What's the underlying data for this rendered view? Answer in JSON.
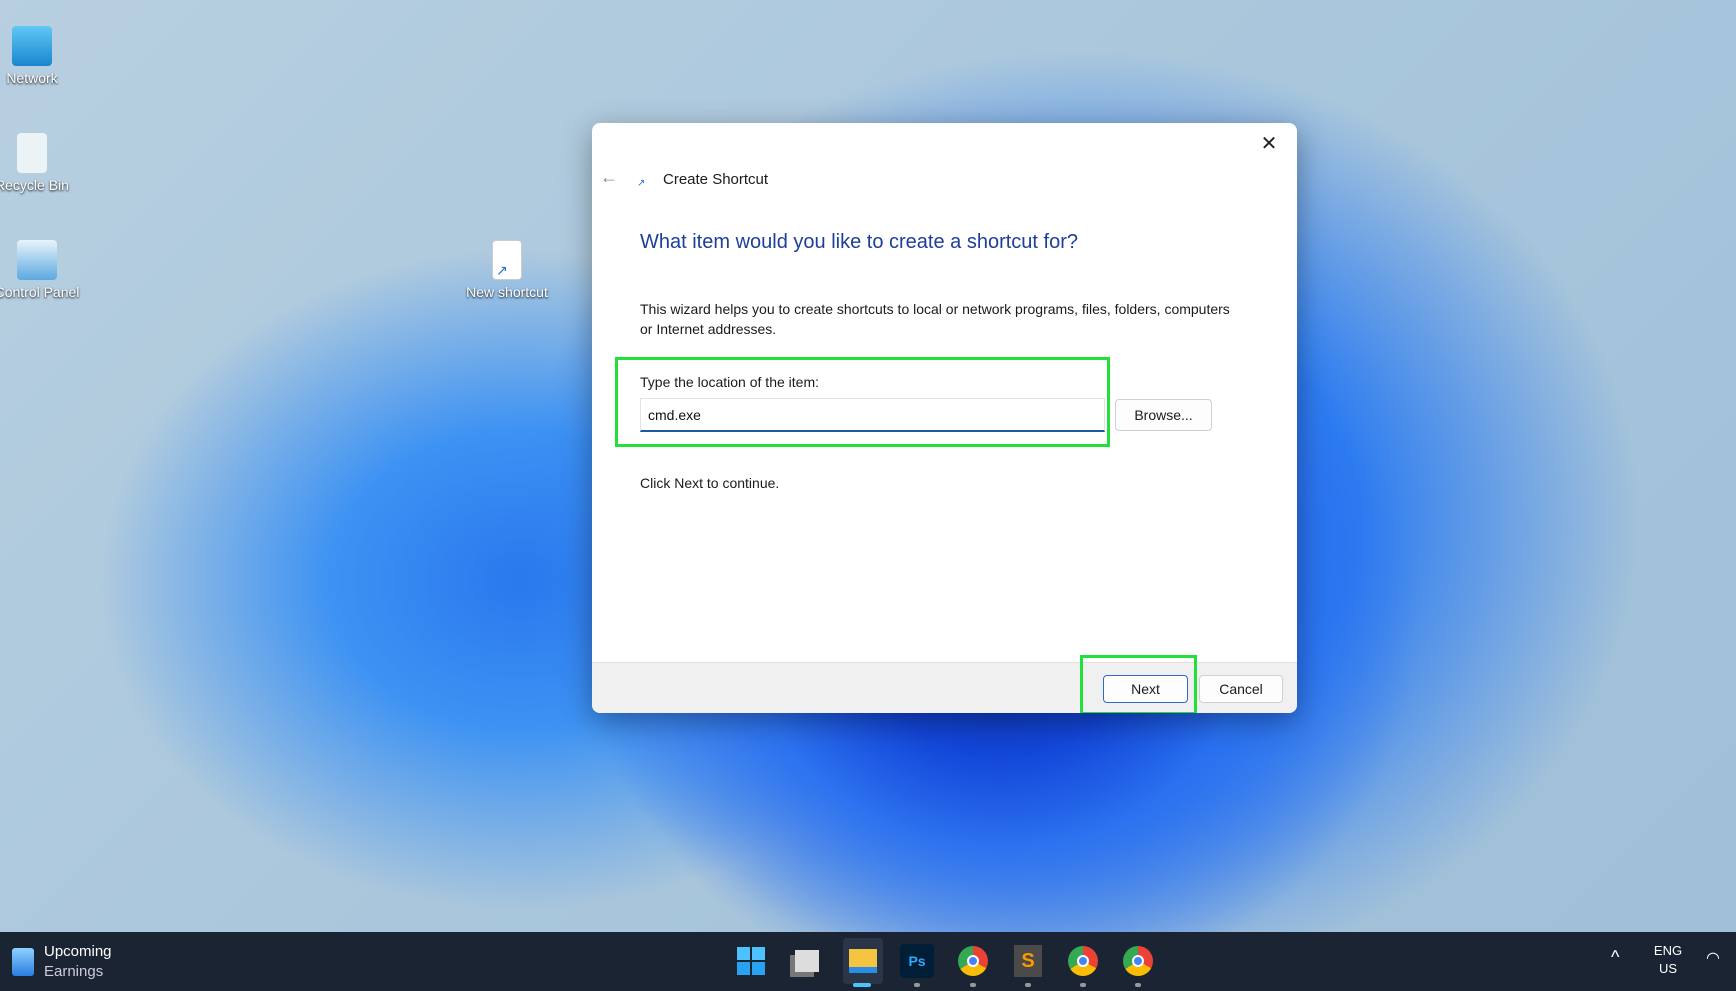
{
  "desktop": {
    "icons": [
      {
        "label": "Network"
      },
      {
        "label": "Recycle Bin"
      },
      {
        "label": "Control Panel"
      },
      {
        "label": "New shortcut"
      }
    ]
  },
  "dialog": {
    "title": "Create Shortcut",
    "close_icon": "close-icon",
    "back_icon": "back-arrow-icon",
    "heading": "What item would you like to create a shortcut for?",
    "description": "This wizard helps you to create shortcuts to local or network programs, files, folders, computers or Internet addresses.",
    "location_label": "Type the location of the item:",
    "location_value": "cmd.exe",
    "browse_label": "Browse...",
    "continue_text": "Click Next to continue.",
    "next_label": "Next",
    "cancel_label": "Cancel",
    "highlight_color": "#22e03a"
  },
  "taskbar": {
    "widget": {
      "line1": "Upcoming",
      "line2": "Earnings"
    },
    "apps": [
      "start",
      "task-view",
      "file-explorer",
      "photoshop",
      "chrome-profile-r",
      "sublime-text",
      "chrome-profile-2",
      "chrome-profile-3"
    ],
    "photoshop_label": "Ps",
    "language": {
      "line1": "ENG",
      "line2": "US"
    }
  }
}
